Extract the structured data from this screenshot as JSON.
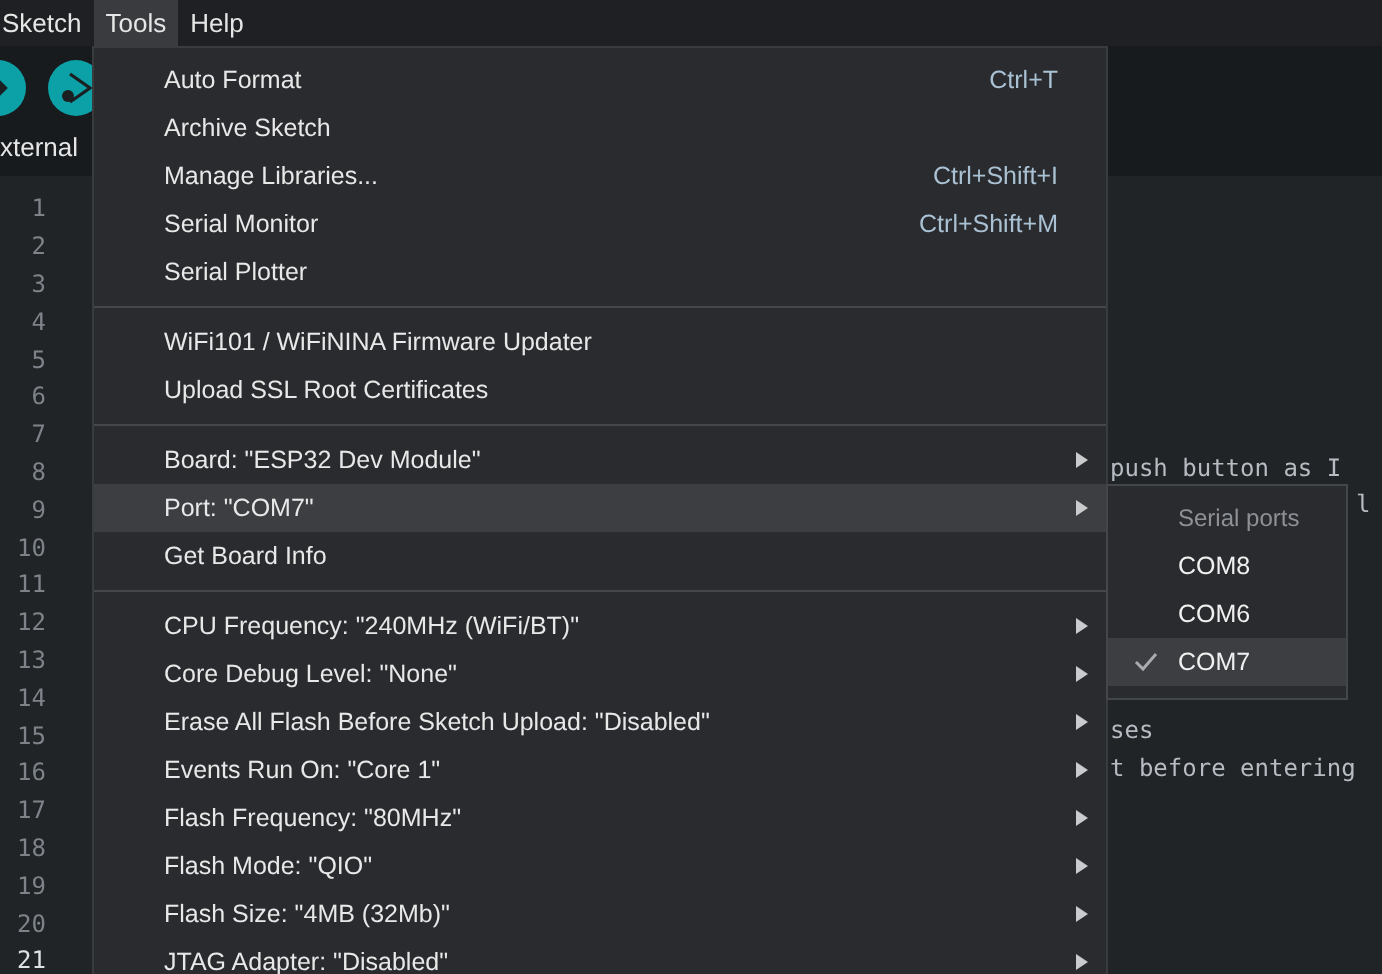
{
  "menubar": [
    {
      "label": "Sketch",
      "selected": false
    },
    {
      "label": "Tools",
      "selected": true
    },
    {
      "label": "Help",
      "selected": false
    }
  ],
  "toolbar": {
    "buttons": [
      {
        "kind": "upload"
      },
      {
        "kind": "debug"
      }
    ]
  },
  "tab": {
    "label": "xternal"
  },
  "editor": {
    "lines": [
      {
        "number": "1",
        "current": false
      },
      {
        "number": "2",
        "current": false
      },
      {
        "number": "3",
        "current": false
      },
      {
        "number": "4",
        "current": false
      },
      {
        "number": "5",
        "current": false
      },
      {
        "number": "6",
        "current": false
      },
      {
        "number": "7",
        "current": false
      },
      {
        "number": "8",
        "current": false,
        "text": "push button as I"
      },
      {
        "number": "9",
        "current": false,
        "text": "l"
      },
      {
        "number": "10",
        "current": false
      },
      {
        "number": "11",
        "current": false
      },
      {
        "number": "12",
        "current": false
      },
      {
        "number": "13",
        "current": false
      },
      {
        "number": "14",
        "current": false
      },
      {
        "number": "15",
        "current": false,
        "text": "ses"
      },
      {
        "number": "16",
        "current": false,
        "text": "t before entering"
      },
      {
        "number": "17",
        "current": false
      },
      {
        "number": "18",
        "current": false
      },
      {
        "number": "19",
        "current": false
      },
      {
        "number": "20",
        "current": false
      },
      {
        "number": "21",
        "current": true
      }
    ]
  },
  "tools_menu": {
    "groups": [
      [
        {
          "label": "Auto Format",
          "shortcut": "Ctrl+T",
          "selected": false,
          "submenu": false
        },
        {
          "label": "Archive Sketch",
          "selected": false,
          "submenu": false
        },
        {
          "label": "Manage Libraries...",
          "shortcut": "Ctrl+Shift+I",
          "selected": false,
          "submenu": false
        },
        {
          "label": "Serial Monitor",
          "shortcut": "Ctrl+Shift+M",
          "selected": false,
          "submenu": false
        },
        {
          "label": "Serial Plotter",
          "selected": false,
          "submenu": false
        }
      ],
      [
        {
          "label": "WiFi101 / WiFiNINA Firmware Updater",
          "selected": false,
          "submenu": false
        },
        {
          "label": "Upload SSL Root Certificates",
          "selected": false,
          "submenu": false
        }
      ],
      [
        {
          "label": "Board: \"ESP32 Dev Module\"",
          "selected": false,
          "submenu": true
        },
        {
          "label": "Port: \"COM7\"",
          "selected": true,
          "submenu": true
        },
        {
          "label": "Get Board Info",
          "selected": false,
          "submenu": false
        }
      ],
      [
        {
          "label": "CPU Frequency: \"240MHz (WiFi/BT)\"",
          "selected": false,
          "submenu": true
        },
        {
          "label": "Core Debug Level: \"None\"",
          "selected": false,
          "submenu": true
        },
        {
          "label": "Erase All Flash Before Sketch Upload: \"Disabled\"",
          "selected": false,
          "submenu": true
        },
        {
          "label": "Events Run On: \"Core 1\"",
          "selected": false,
          "submenu": true
        },
        {
          "label": "Flash Frequency: \"80MHz\"",
          "selected": false,
          "submenu": true
        },
        {
          "label": "Flash Mode: \"QIO\"",
          "selected": false,
          "submenu": true
        },
        {
          "label": "Flash Size: \"4MB (32Mb)\"",
          "selected": false,
          "submenu": true
        },
        {
          "label": "JTAG Adapter: \"Disabled\"",
          "selected": false,
          "submenu": true
        }
      ]
    ]
  },
  "port_submenu": {
    "header": "Serial ports",
    "items": [
      {
        "label": "COM8",
        "selected": false
      },
      {
        "label": "COM6",
        "selected": false
      },
      {
        "label": "COM7",
        "selected": true
      }
    ]
  }
}
